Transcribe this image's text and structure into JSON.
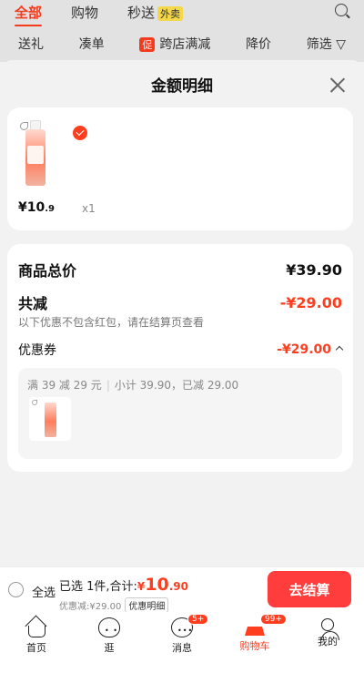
{
  "top_tabs": [
    {
      "label": "全部",
      "active": true
    },
    {
      "label": "购物",
      "active": false
    },
    {
      "label": "秒送",
      "active": false,
      "badge": "外卖"
    }
  ],
  "filters": {
    "gift": "送礼",
    "combine": "凑单",
    "promo_tag": "促",
    "cross_store": "跨店满减",
    "price_drop": "降价",
    "filter": "筛选"
  },
  "sheet": {
    "title": "金额明细"
  },
  "product": {
    "price_int": "¥10",
    "price_dec": ".9",
    "quantity": "x1"
  },
  "summary": {
    "total_label": "商品总价",
    "total_value": "¥39.90",
    "discount_label": "共减",
    "discount_value": "-¥29.00",
    "discount_note": "以下优惠不包含红包，请在结算页查看",
    "coupon_label": "优惠券",
    "coupon_value": "-¥29.00"
  },
  "coupon": {
    "rule": "满 39 减 29 元",
    "subtotal": "小计 39.90，已减 29.00"
  },
  "checkout": {
    "select_all": "全选",
    "selected_text": "已选 1件,合计:",
    "currency": "¥",
    "total_int": "10",
    "total_dec": ".90",
    "discount_text": "优惠减:¥29.00",
    "detail_label": "优惠明细",
    "checkout_label": "去结算"
  },
  "tabbar": [
    {
      "label": "首页",
      "icon": "home-icon"
    },
    {
      "label": "逛",
      "icon": "face-icon"
    },
    {
      "label": "消息",
      "icon": "message-icon",
      "badge": "5+"
    },
    {
      "label": "购物车",
      "icon": "cart-icon",
      "badge": "99+",
      "active": true
    },
    {
      "label": "我的",
      "icon": "profile-icon"
    }
  ],
  "colors": {
    "accent": "#ff3d1f",
    "checkout_button": "#ff3d3d"
  }
}
